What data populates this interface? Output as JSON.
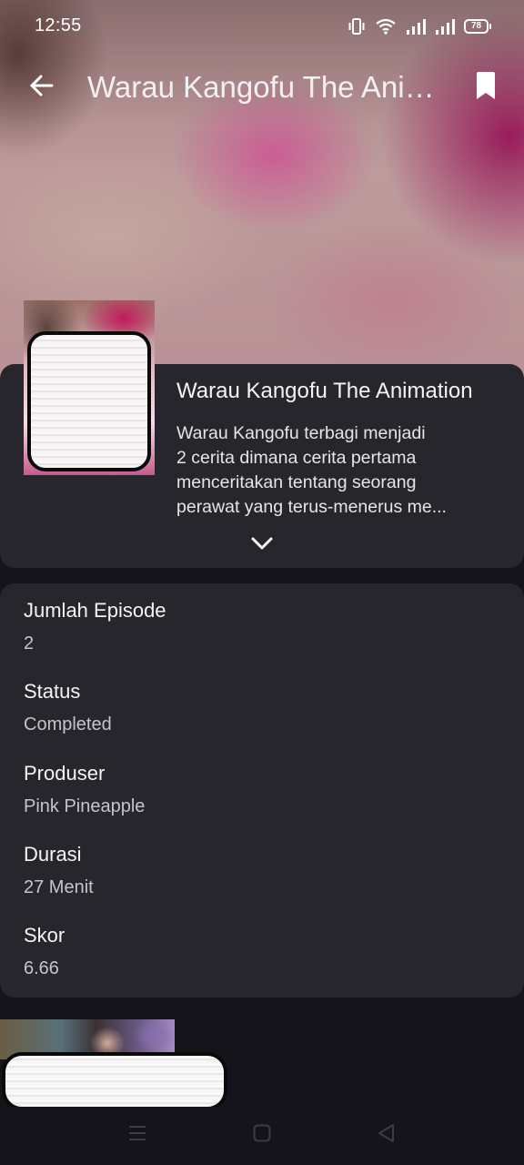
{
  "status_bar": {
    "time": "12:55",
    "battery": "78",
    "icons": [
      "vibrate-icon",
      "wifi-icon",
      "signal-icon",
      "signal-icon",
      "battery-icon"
    ]
  },
  "app_bar": {
    "title": "Warau Kangofu The Animation",
    "back_icon": "arrow-left-icon",
    "bookmark_icon": "bookmark-icon"
  },
  "anime": {
    "title": "Warau Kangofu The Animation",
    "synopsis_lines": [
      "Warau Kangofu terbagi menjadi",
      "2 cerita dimana cerita pertama",
      "menceritakan tentang seorang",
      "perawat yang terus-menerus me..."
    ],
    "expand_icon": "chevron-down-icon"
  },
  "details": [
    {
      "label": "Jumlah Episode",
      "value": "2"
    },
    {
      "label": "Status",
      "value": "Completed"
    },
    {
      "label": "Produser",
      "value": "Pink Pineapple"
    },
    {
      "label": "Durasi",
      "value": "27 Menit"
    },
    {
      "label": "Skor",
      "value": "6.66"
    }
  ],
  "nav_bar": {
    "icons": [
      "menu-icon",
      "home-square-icon",
      "back-triangle-icon"
    ]
  },
  "colors": {
    "background": "#15141a",
    "card": "#27262d",
    "text_primary": "#f4f4f6",
    "text_secondary": "#c4c4ca"
  }
}
